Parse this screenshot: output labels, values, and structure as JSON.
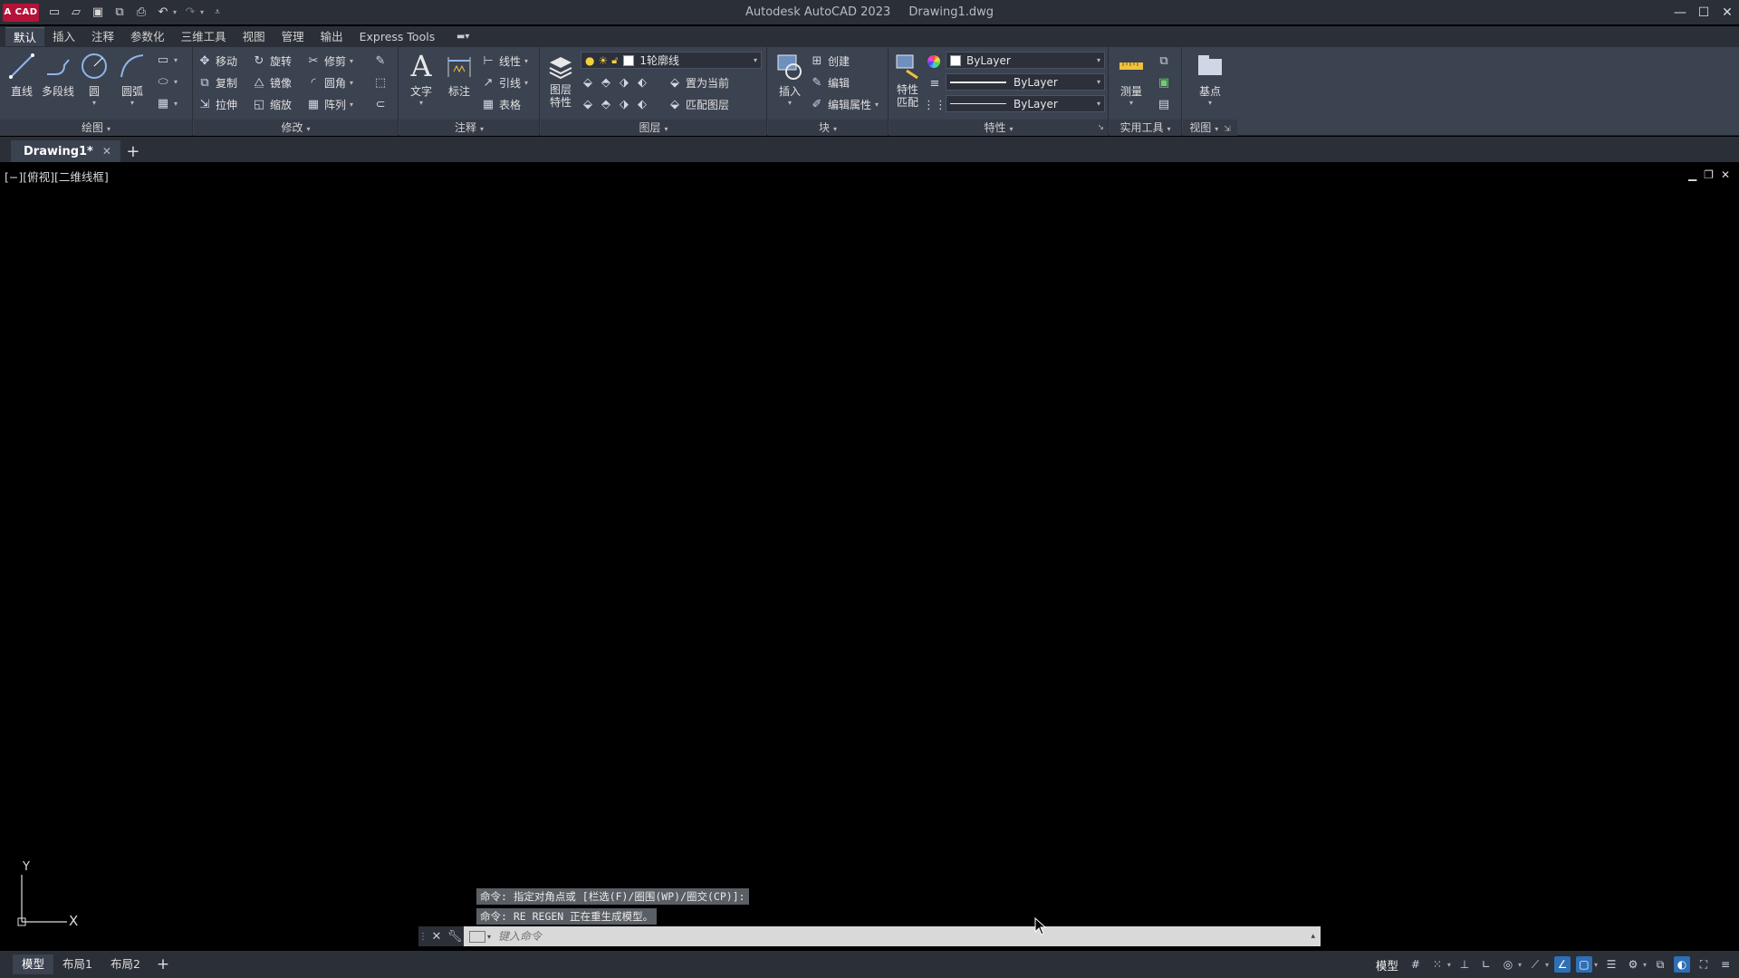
{
  "titlebar": {
    "logo": "A CAD",
    "app_title": "Autodesk AutoCAD 2023",
    "file_name": "Drawing1.dwg"
  },
  "ribbon_tabs": [
    "默认",
    "插入",
    "注释",
    "参数化",
    "三维工具",
    "视图",
    "管理",
    "输出",
    "Express Tools"
  ],
  "panels": {
    "draw": {
      "title": "绘图",
      "line": "直线",
      "polyline": "多段线",
      "circle": "圆",
      "arc": "圆弧"
    },
    "modify": {
      "title": "修改",
      "move": "移动",
      "rotate": "旋转",
      "trim": "修剪",
      "copy": "复制",
      "mirror": "镜像",
      "fillet": "圆角",
      "stretch": "拉伸",
      "scale": "缩放",
      "array": "阵列"
    },
    "annotation": {
      "title": "注释",
      "text": "文字",
      "dimension": "标注",
      "linear": "线性",
      "leader": "引线",
      "table": "表格"
    },
    "layers": {
      "title": "图层",
      "layer_properties_line1": "图层",
      "layer_properties_line2": "特性",
      "current_layer": "1轮廓线",
      "set_current": "置为当前",
      "match_layer": "匹配图层"
    },
    "block": {
      "title": "块",
      "insert": "插入",
      "create": "创建",
      "edit": "编辑",
      "edit_attributes": "编辑属性"
    },
    "properties": {
      "title": "特性",
      "match_line1": "特性",
      "match_line2": "匹配",
      "color": "ByLayer",
      "lineweight": "ByLayer",
      "linetype": "ByLayer"
    },
    "utilities": {
      "title": "实用工具",
      "measure": "测量"
    },
    "view": {
      "title": "视图",
      "base": "基点"
    }
  },
  "document_tabs": [
    {
      "label": "Drawing1*"
    }
  ],
  "viewport": {
    "label": "[−][俯视][二维线框]"
  },
  "ucs": {
    "x_label": "X",
    "y_label": "Y"
  },
  "command": {
    "history": [
      "命令: 指定对角点或 [栏选(F)/圈围(WP)/圈交(CP)]:",
      "命令: RE REGEN 正在重生成模型。"
    ],
    "placeholder": "键入命令"
  },
  "status": {
    "layout_tabs": [
      "模型",
      "布局1",
      "布局2"
    ],
    "model_label": "模型"
  },
  "colors": {
    "accent": "#2f6fb5",
    "logo": "#b5123a",
    "ribbon_bg": "#3b4250",
    "titlebar_bg": "#2b2f37"
  }
}
